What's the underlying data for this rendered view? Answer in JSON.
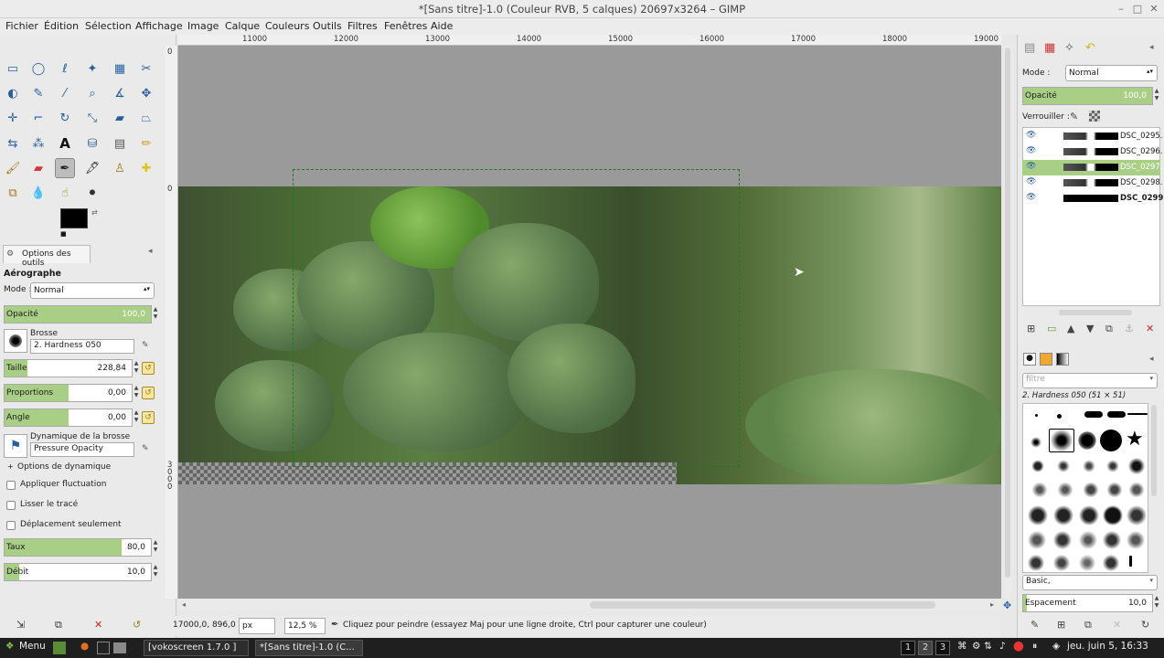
{
  "window": {
    "title": "*[Sans titre]-1.0 (Couleur RVB, 5 calques) 20697x3264 – GIMP",
    "controls": [
      "–",
      "□",
      "✕"
    ]
  },
  "menu": [
    "Fichier",
    "Édition",
    "Sélection",
    "Affichage",
    "Image",
    "Calque",
    "Couleurs",
    "Outils",
    "Filtres",
    "Fenêtres",
    "Aide"
  ],
  "ruler": {
    "top": [
      "11000",
      "12000",
      "13000",
      "14000",
      "15000",
      "16000",
      "17000",
      "18000",
      "19000"
    ],
    "left_0": "0",
    "left_mid": "0",
    "left_low": "3 0 0 0"
  },
  "tool_options": {
    "tab_label": "Options des outils",
    "tool_name": "Aérographe",
    "mode_label": "Mode :",
    "mode_value": "Normal",
    "opacity_label": "Opacité",
    "opacity_value": "100,0",
    "opacity_fill": 1.0,
    "brush_label": "Brosse",
    "brush_value": "2. Hardness 050",
    "size_label": "Taille",
    "size_value": "228,84",
    "size_fill": 0.18,
    "ratio_label": "Proportions",
    "ratio_value": "0,00",
    "ratio_fill": 0.5,
    "angle_label": "Angle",
    "angle_value": "0,00",
    "angle_fill": 0.5,
    "dynamics_label": "Dynamique de la brosse",
    "dynamics_value": "Pressure Opacity",
    "dynamics_options": "Options de dynamique",
    "apply_jitter": "Appliquer fluctuation",
    "smooth_stroke": "Lisser le tracé",
    "incremental": "Déplacement seulement",
    "rate_label": "Taux",
    "rate_value": "80,0",
    "rate_fill": 0.8,
    "flow_label": "Débit",
    "flow_value": "10,0",
    "flow_fill": 0.1
  },
  "status": {
    "coords": "17000,0, 896,0",
    "unit": "px",
    "zoom": "12,5 %",
    "message": "Cliquez pour peindre (essayez Maj pour une ligne droite, Ctrl pour capturer une couleur)"
  },
  "layers_panel": {
    "mode_label": "Mode :",
    "mode_value": "Normal",
    "opacity_label": "Opacité",
    "opacity_value": "100,0",
    "lock_label": "Verrouiller :",
    "layers": [
      {
        "name": "DSC_0295.",
        "selected": false,
        "bold": false
      },
      {
        "name": "DSC_0296.",
        "selected": false,
        "bold": false
      },
      {
        "name": "DSC_0297.",
        "selected": true,
        "bold": false
      },
      {
        "name": "DSC_0298.",
        "selected": false,
        "bold": false
      },
      {
        "name": "DSC_0299.JPG",
        "selected": false,
        "bold": true
      }
    ]
  },
  "brushes_panel": {
    "filter_placeholder": "filtre",
    "current_brush": "2. Hardness 050 (51 × 51)",
    "tag_value": "Basic,",
    "spacing_label": "Espacement",
    "spacing_value": "10,0"
  },
  "taskbar": {
    "menu_label": "Menu",
    "tasks": [
      "[vokoscreen 1.7.0 ]",
      "*[Sans titre]-1.0 (C..."
    ],
    "workspaces": [
      "1",
      "2",
      "3"
    ],
    "clock": "jeu. juin 5, 16:33"
  },
  "colors": {
    "accent_green": "#a9cf86",
    "selected_row": "#a9cf86"
  }
}
